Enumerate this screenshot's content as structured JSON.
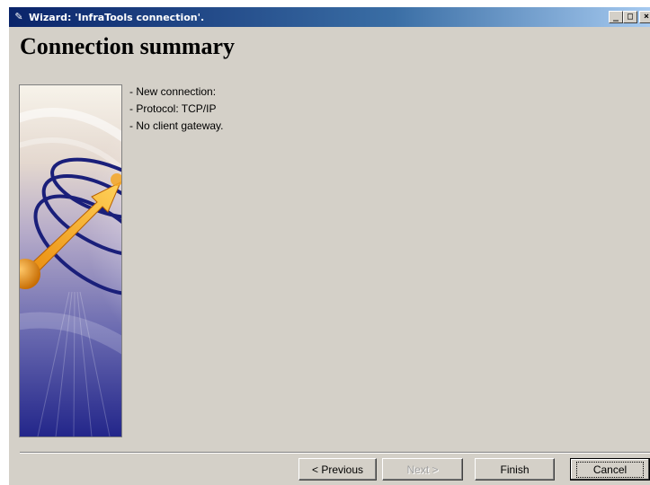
{
  "window": {
    "title": "Wizard: 'InfraTools connection'.",
    "controls": {
      "minimize": "_",
      "maximize": "□",
      "close": "×"
    }
  },
  "page": {
    "heading": "Connection summary"
  },
  "summary": {
    "lines": [
      "- New connection:",
      "- Protocol: TCP/IP",
      "- No client gateway."
    ]
  },
  "buttons": {
    "previous": {
      "label": "< Previous",
      "mnemonic": "P",
      "enabled": true
    },
    "next": {
      "label": "Next >",
      "mnemonic": "N",
      "enabled": false
    },
    "finish": {
      "label": "Finish",
      "mnemonic": "F",
      "enabled": true
    },
    "cancel": {
      "label": "Cancel",
      "enabled": true,
      "focused": true
    }
  },
  "icons": {
    "title": "wizard-wand-icon",
    "side_image": "connection-orbit-arrow-graphic"
  },
  "colors": {
    "titlebar_start": "#0a246a",
    "titlebar_end": "#a6caf0",
    "dialog_face": "#d4d0c8",
    "image_accent": "#f5a623"
  }
}
